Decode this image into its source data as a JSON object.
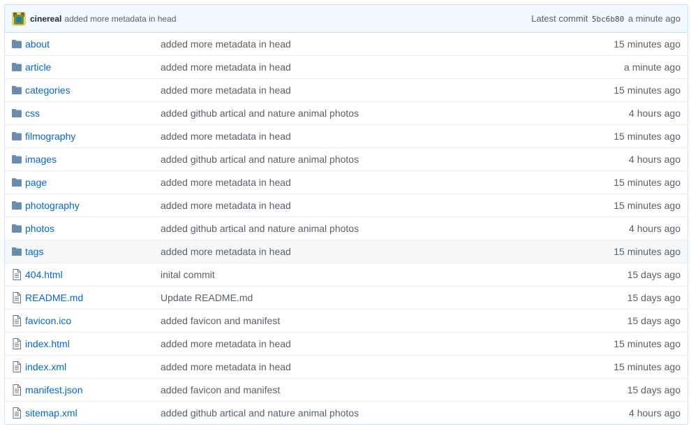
{
  "commit": {
    "author": "cinereal",
    "message": "added more metadata in head",
    "latest_label": "Latest commit",
    "sha": "5bc6b80",
    "age": "a minute ago"
  },
  "colors": {
    "link": "#0366d6",
    "muted": "#586069",
    "folder": "#79b8ff",
    "header_bg": "#f1f8ff"
  },
  "files": [
    {
      "name": "about",
      "type": "folder",
      "message": "added more metadata in head",
      "age": "15 minutes ago"
    },
    {
      "name": "article",
      "type": "folder",
      "message": "added more metadata in head",
      "age": "a minute ago"
    },
    {
      "name": "categories",
      "type": "folder",
      "message": "added more metadata in head",
      "age": "15 minutes ago"
    },
    {
      "name": "css",
      "type": "folder",
      "message": "added github artical and nature animal photos",
      "age": "4 hours ago"
    },
    {
      "name": "filmography",
      "type": "folder",
      "message": "added more metadata in head",
      "age": "15 minutes ago"
    },
    {
      "name": "images",
      "type": "folder",
      "message": "added github artical and nature animal photos",
      "age": "4 hours ago"
    },
    {
      "name": "page",
      "type": "folder",
      "message": "added more metadata in head",
      "age": "15 minutes ago"
    },
    {
      "name": "photography",
      "type": "folder",
      "message": "added more metadata in head",
      "age": "15 minutes ago"
    },
    {
      "name": "photos",
      "type": "folder",
      "message": "added github artical and nature animal photos",
      "age": "4 hours ago"
    },
    {
      "name": "tags",
      "type": "folder",
      "message": "added more metadata in head",
      "age": "15 minutes ago",
      "hover": true
    },
    {
      "name": "404.html",
      "type": "file",
      "message": "inital commit",
      "age": "15 days ago"
    },
    {
      "name": "README.md",
      "type": "file",
      "message": "Update README.md",
      "age": "15 days ago"
    },
    {
      "name": "favicon.ico",
      "type": "file",
      "message": "added favicon and manifest",
      "age": "15 days ago"
    },
    {
      "name": "index.html",
      "type": "file",
      "message": "added more metadata in head",
      "age": "15 minutes ago"
    },
    {
      "name": "index.xml",
      "type": "file",
      "message": "added more metadata in head",
      "age": "15 minutes ago"
    },
    {
      "name": "manifest.json",
      "type": "file",
      "message": "added favicon and manifest",
      "age": "15 days ago"
    },
    {
      "name": "sitemap.xml",
      "type": "file",
      "message": "added github artical and nature animal photos",
      "age": "4 hours ago"
    }
  ]
}
